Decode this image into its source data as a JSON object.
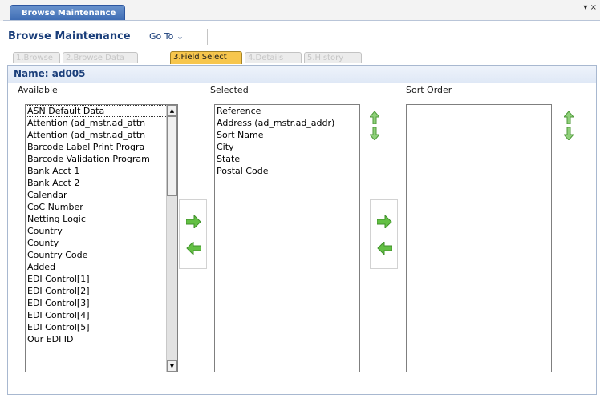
{
  "outer_tab": {
    "label": "Browse Maintenance"
  },
  "window_controls": {
    "label": "▾ ×"
  },
  "header": {
    "title": "Browse Maintenance",
    "goto_label": "Go To ⌄"
  },
  "steps": [
    {
      "label": "1.Browse",
      "active": false
    },
    {
      "label": "2.Browse Data",
      "active": false
    },
    {
      "label": "3.Field Select",
      "active": true
    },
    {
      "label": "4.Details",
      "active": false
    },
    {
      "label": "5.History",
      "active": false
    }
  ],
  "panel": {
    "name_label": "Name: ad005",
    "available_label": "Available",
    "selected_label": "Selected",
    "sort_order_label": "Sort Order"
  },
  "available_items": [
    "ASN Default Data",
    "Attention (ad_mstr.ad_attn",
    "Attention (ad_mstr.ad_attn",
    "Barcode Label Print Progra",
    "Barcode Validation Program",
    "Bank Acct 1",
    "Bank Acct 2",
    "Calendar",
    "CoC Number",
    "Netting Logic",
    "Country",
    "County",
    "Country Code",
    "Added",
    "EDI Control[1]",
    "EDI Control[2]",
    "EDI Control[3]",
    "EDI Control[4]",
    "EDI Control[5]",
    "Our EDI ID"
  ],
  "selected_items": [
    "Reference",
    "Address (ad_mstr.ad_addr)",
    "Sort Name",
    "City",
    "State",
    "Postal Code"
  ],
  "sort_order_items": [],
  "colors": {
    "accent_blue": "#1a3e7a",
    "active_step": "#f7c64d",
    "arrow_green": "#63c044"
  }
}
